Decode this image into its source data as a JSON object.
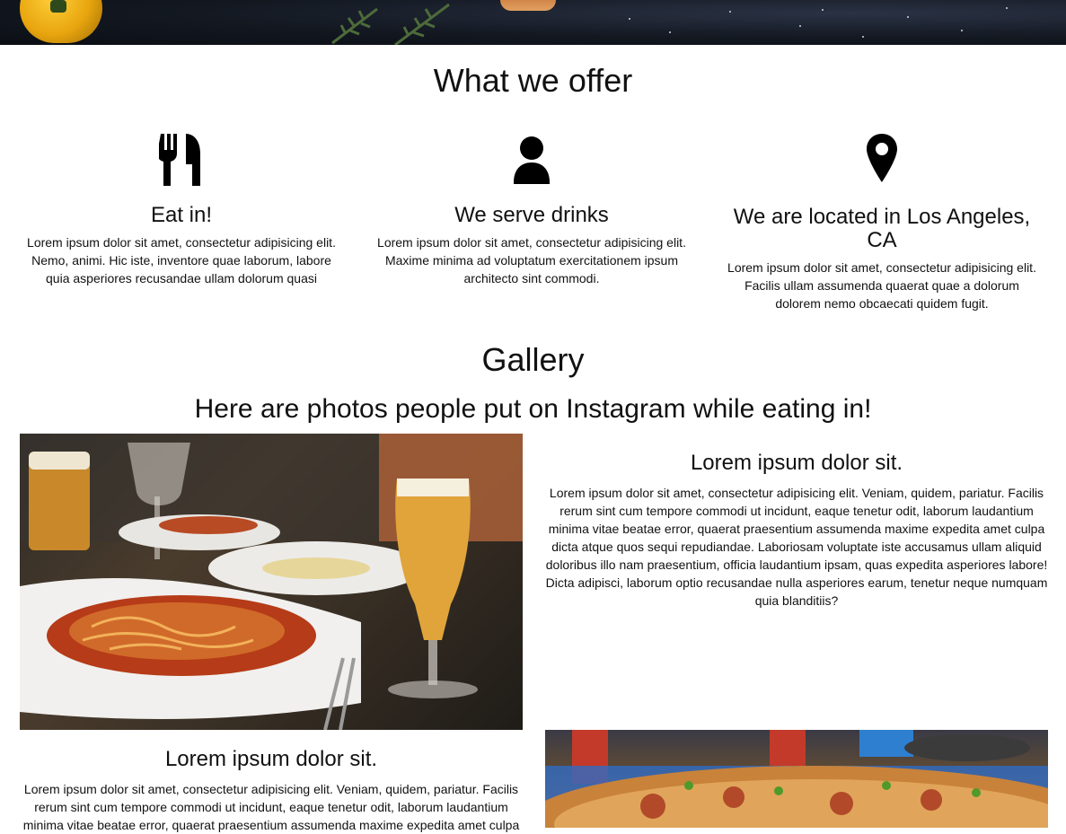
{
  "offer": {
    "title": "What we offer",
    "features": [
      {
        "icon": "fork-knife-icon",
        "title": "Eat in!",
        "text": "Lorem ipsum dolor sit amet, consectetur adipisicing elit. Nemo, animi. Hic iste, inventore quae laborum, labore quia asperiores recusandae ullam dolorum quasi"
      },
      {
        "icon": "user-icon",
        "title": "We serve drinks",
        "text": "Lorem ipsum dolor sit amet, consectetur adipisicing elit. Maxime minima ad voluptatum exercitationem ipsum architecto sint commodi."
      },
      {
        "icon": "map-marker-icon",
        "title": "We are located in Los Angeles, CA",
        "text": "Lorem ipsum dolor sit amet, consectetur adipisicing elit. Facilis ullam assumenda quaerat quae a dolorum dolorem nemo obcaecati quidem fugit."
      }
    ]
  },
  "gallery": {
    "title": "Gallery",
    "subtitle": "Here are photos people put on Instagram while eating in!",
    "items": [
      {
        "heading": "Lorem ipsum dolor sit.",
        "text": "Lorem ipsum dolor sit amet, consectetur adipisicing elit. Veniam, quidem, pariatur. Facilis rerum sint cum tempore commodi ut incidunt, eaque tenetur odit, laborum laudantium minima vitae beatae error, quaerat praesentium assumenda maxime expedita amet culpa dicta atque quos sequi repudiandae. Laboriosam voluptate iste accusamus ullam aliquid doloribus illo nam praesentium, officia laudantium ipsam, quas expedita asperiores labore! Dicta adipisci, laborum optio recusandae nulla asperiores earum, tenetur neque numquam quia blanditiis?"
      },
      {
        "heading": "Lorem ipsum dolor sit.",
        "text": "Lorem ipsum dolor sit amet, consectetur adipisicing elit. Veniam, quidem, pariatur. Facilis rerum sint cum tempore commodi ut incidunt, eaque tenetur odit, laborum laudantium minima vitae beatae error, quaerat praesentium assumenda maxime expedita amet culpa"
      }
    ]
  }
}
